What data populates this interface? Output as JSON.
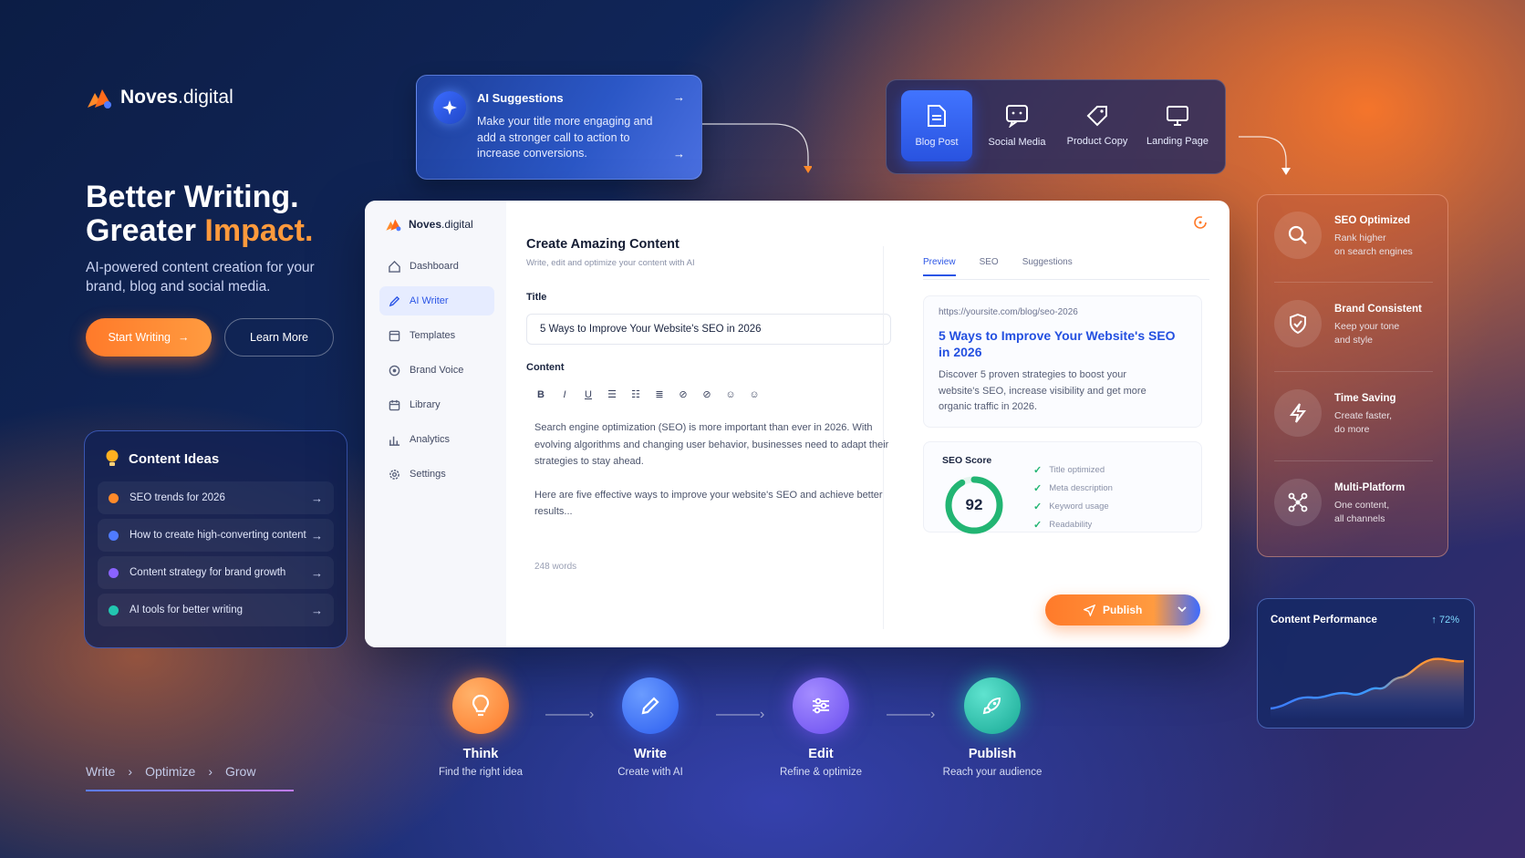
{
  "brand": {
    "name_bold": "Noves",
    "name_rest": ".digital"
  },
  "hero": {
    "line1": "Better Writing.",
    "line2_plain": "Greater ",
    "line2_accent": "Impact.",
    "subtitle": "AI-powered content creation for your brand, blog and social media.",
    "start_label": "Start Writing",
    "learn_label": "Learn More"
  },
  "ideas": {
    "title": "Content Ideas",
    "items": [
      {
        "label": "SEO trends for 2026",
        "color": "#ff8a2a"
      },
      {
        "label": "How to create high-converting content",
        "color": "#4f7bff"
      },
      {
        "label": "Content strategy for brand growth",
        "color": "#8a63ff"
      },
      {
        "label": "AI tools for better writing",
        "color": "#22c6b0"
      }
    ]
  },
  "ai_suggestions": {
    "title": "AI Suggestions",
    "text": "Make your title more engaging and add a stronger call to action to increase conversions."
  },
  "content_types": [
    {
      "label": "Blog Post",
      "icon": "document-icon",
      "active": true
    },
    {
      "label": "Social Media",
      "icon": "chat-icon",
      "active": false
    },
    {
      "label": "Product Copy",
      "icon": "tag-icon",
      "active": false
    },
    {
      "label": "Landing Page",
      "icon": "monitor-icon",
      "active": false
    }
  ],
  "features": [
    {
      "title": "SEO Optimized",
      "desc1": "Rank higher",
      "desc2": "on search engines",
      "icon": "search-icon"
    },
    {
      "title": "Brand Consistent",
      "desc1": "Keep your tone",
      "desc2": "and style",
      "icon": "shield-icon"
    },
    {
      "title": "Time Saving",
      "desc1": "Create faster,",
      "desc2": "do more",
      "icon": "lightning-icon"
    },
    {
      "title": "Multi-Platform",
      "desc1": "One content,",
      "desc2": "all channels",
      "icon": "network-icon"
    }
  ],
  "performance": {
    "title": "Content Performance",
    "change": "↑ 72%"
  },
  "app": {
    "brand_bold": "Noves",
    "brand_rest": ".digital",
    "nav": [
      {
        "label": "Dashboard",
        "icon": "home-icon",
        "active": false
      },
      {
        "label": "AI Writer",
        "icon": "pen-icon",
        "active": true
      },
      {
        "label": "Templates",
        "icon": "template-icon",
        "active": false
      },
      {
        "label": "Brand Voice",
        "icon": "target-icon",
        "active": false
      },
      {
        "label": "Library",
        "icon": "calendar-icon",
        "active": false
      },
      {
        "label": "Analytics",
        "icon": "bar-chart-icon",
        "active": false
      },
      {
        "label": "Settings",
        "icon": "gear-icon",
        "active": false
      }
    ],
    "title": "Create Amazing Content",
    "subtitle": "Write, edit and optimize your content with AI",
    "title_label": "Title",
    "title_value": "5 Ways to Improve Your Website's SEO in 2026",
    "content_label": "Content",
    "toolbar": [
      "B",
      "I",
      "U",
      "☰",
      "☷",
      "≣",
      "⊘",
      "⊘",
      "☺",
      "☺"
    ],
    "paragraph1": "Search engine optimization (SEO) is more important than ever in 2026. With evolving algorithms and changing user behavior, businesses need to adapt their strategies to stay ahead.",
    "paragraph2": "Here are five effective ways to improve your website's SEO and achieve better results...",
    "word_count": "248 words",
    "tabs": [
      {
        "label": "Preview",
        "active": true
      },
      {
        "label": "SEO",
        "active": false
      },
      {
        "label": "Suggestions",
        "active": false
      }
    ],
    "preview_url": "https://yoursite.com/blog/seo-2026",
    "preview_title": "5 Ways to Improve Your Website's SEO in 2026",
    "preview_desc": "Discover 5 proven strategies to boost your website's SEO, increase visibility and get more organic traffic in 2026.",
    "seo_label": "SEO Score",
    "seo_score": "92",
    "seo_fraction": 0.92,
    "checks": [
      "Title optimized",
      "Meta description",
      "Keyword usage",
      "Readability"
    ],
    "publish_label": "Publish"
  },
  "steps": [
    {
      "name": "Think",
      "desc": "Find the right idea",
      "color": "#ff8a2a",
      "icon": "lightbulb-icon"
    },
    {
      "name": "Write",
      "desc": "Create with AI",
      "color": "#3d72ff",
      "icon": "pencil-icon"
    },
    {
      "name": "Edit",
      "desc": "Refine & optimize",
      "color": "#7d5cff",
      "icon": "sliders-icon"
    },
    {
      "name": "Publish",
      "desc": "Reach your audience",
      "color": "#20c2b0",
      "icon": "rocket-icon"
    }
  ],
  "crumbs": [
    "Write",
    "Optimize",
    "Grow"
  ]
}
